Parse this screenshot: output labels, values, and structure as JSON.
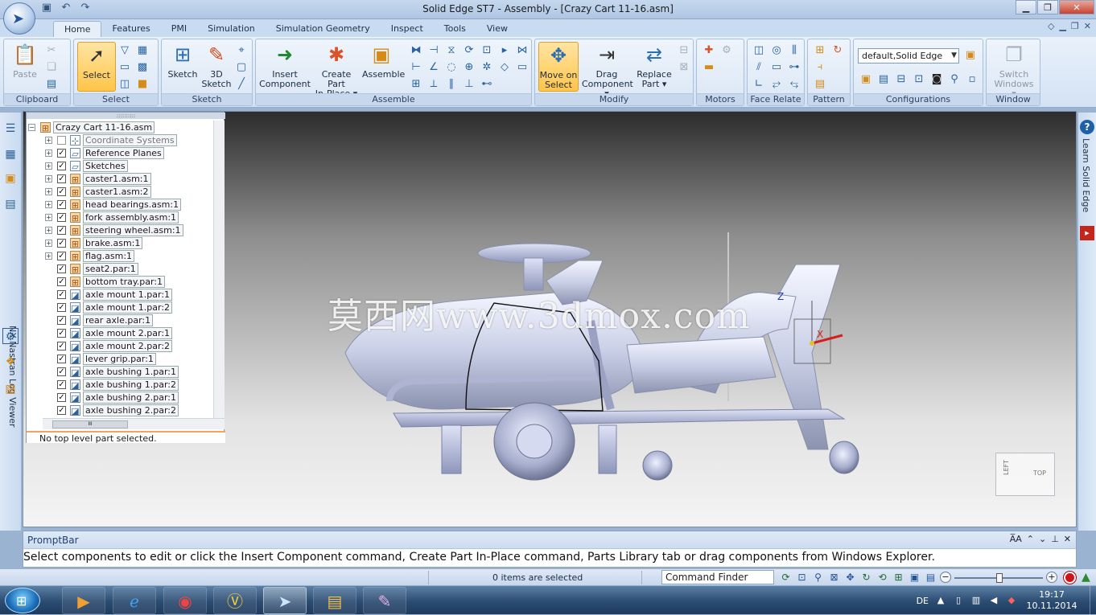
{
  "window": {
    "title": "Solid Edge ST7 - Assembly - [Crazy Cart 11-16.asm]"
  },
  "quick_access": [
    "save-icon",
    "undo-icon",
    "redo-icon"
  ],
  "tabs": [
    {
      "label": "Home",
      "active": true
    },
    {
      "label": "Features"
    },
    {
      "label": "PMI"
    },
    {
      "label": "Simulation"
    },
    {
      "label": "Simulation Geometry"
    },
    {
      "label": "Inspect"
    },
    {
      "label": "Tools"
    },
    {
      "label": "View"
    }
  ],
  "ribbon": {
    "clipboard": {
      "label": "Clipboard",
      "paste": "Paste"
    },
    "select": {
      "label": "Select",
      "select": "Select"
    },
    "sketch": {
      "label": "Sketch",
      "sketch": "Sketch",
      "sketch3d_1": "3D",
      "sketch3d_2": "Sketch"
    },
    "assemble": {
      "label": "Assemble",
      "insert_1": "Insert",
      "insert_2": "Component",
      "create_1": "Create Part",
      "create_2": "In-Place ▾",
      "assemble": "Assemble"
    },
    "modify": {
      "label": "Modify",
      "move_1": "Move on",
      "move_2": "Select",
      "drag_1": "Drag",
      "drag_2": "Component ▾",
      "replace_1": "Replace",
      "replace_2": "Part ▾"
    },
    "motors": {
      "label": "Motors"
    },
    "face_relate": {
      "label": "Face Relate"
    },
    "pattern": {
      "label": "Pattern"
    },
    "configurations": {
      "label": "Configurations",
      "value": "default,Solid Edge"
    },
    "window": {
      "label": "Window",
      "switch_1": "Switch",
      "switch_2": "Windows ▾"
    }
  },
  "left_toolbar": {
    "nx_label": "NX Nastran Log Viewer"
  },
  "right_toolbar": {
    "learn_label": "Learn Solid Edge",
    "youtube_label": "You Tube"
  },
  "pathfinder": {
    "root": "Crazy Cart 11-16.asm",
    "items": [
      {
        "label": "Coordinate Systems",
        "checked": false,
        "expandable": true,
        "kind": "coord"
      },
      {
        "label": "Reference Planes",
        "checked": true,
        "expandable": true,
        "kind": "plane"
      },
      {
        "label": "Sketches",
        "checked": true,
        "expandable": true,
        "kind": "plane"
      },
      {
        "label": "caster1.asm:1",
        "checked": true,
        "expandable": true,
        "kind": "asm"
      },
      {
        "label": "caster1.asm:2",
        "checked": true,
        "expandable": true,
        "kind": "asm"
      },
      {
        "label": "head bearings.asm:1",
        "checked": true,
        "expandable": true,
        "kind": "asm"
      },
      {
        "label": "fork assembly.asm:1",
        "checked": true,
        "expandable": true,
        "kind": "asm"
      },
      {
        "label": "steering wheel.asm:1",
        "checked": true,
        "expandable": true,
        "kind": "asm"
      },
      {
        "label": "brake.asm:1",
        "checked": true,
        "expandable": true,
        "kind": "asm"
      },
      {
        "label": "flag.asm:1",
        "checked": true,
        "expandable": true,
        "kind": "asm"
      },
      {
        "label": "seat2.par:1",
        "checked": true,
        "expandable": false,
        "kind": "asm"
      },
      {
        "label": "bottom tray.par:1",
        "checked": true,
        "expandable": false,
        "kind": "asm"
      },
      {
        "label": "axle mount 1.par:1",
        "checked": true,
        "expandable": false,
        "kind": "part"
      },
      {
        "label": "axle mount 1.par:2",
        "checked": true,
        "expandable": false,
        "kind": "part"
      },
      {
        "label": "rear axle.par:1",
        "checked": true,
        "expandable": false,
        "kind": "part"
      },
      {
        "label": "axle mount 2.par:1",
        "checked": true,
        "expandable": false,
        "kind": "part"
      },
      {
        "label": "axle mount 2.par:2",
        "checked": true,
        "expandable": false,
        "kind": "part"
      },
      {
        "label": "lever grip.par:1",
        "checked": true,
        "expandable": false,
        "kind": "part"
      },
      {
        "label": "axle bushing 1.par:1",
        "checked": true,
        "expandable": false,
        "kind": "part"
      },
      {
        "label": "axle bushing 1.par:2",
        "checked": true,
        "expandable": false,
        "kind": "part"
      },
      {
        "label": "axle bushing 2.par:1",
        "checked": true,
        "expandable": false,
        "kind": "part"
      },
      {
        "label": "axle bushing 2.par:2",
        "checked": true,
        "expandable": false,
        "kind": "part"
      }
    ],
    "status": "No top level part selected."
  },
  "viewport": {
    "watermark": "莫西网www.3dmox.com",
    "axis_z": "Z",
    "axis_x": "X",
    "viewcube_left": "LEFT",
    "viewcube_top": "TOP"
  },
  "promptbar": {
    "title": "PromptBar",
    "message": "Select components to edit or click the Insert Component command, Create Part In-Place command, Parts Library tab or drag components from Windows Explorer."
  },
  "statusbar": {
    "selection": "0 items are selected",
    "command_finder": "Command Finder"
  },
  "taskbar": {
    "language": "DE",
    "time": "19:17",
    "date": "10.11.2014"
  }
}
